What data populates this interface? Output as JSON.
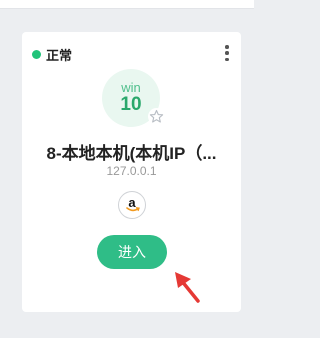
{
  "card": {
    "status_label": "正常",
    "os": {
      "name": "win",
      "version": "10"
    },
    "device_name": "8-本地本机(本机IP（...",
    "ip": "127.0.0.1",
    "provider_icon": "amazon-icon",
    "enter_label": "进入"
  },
  "colors": {
    "status": "#22c37a",
    "accent": "#2fbd87",
    "os_badge_bg": "#e9f7f0",
    "annotation_arrow": "#e53935"
  }
}
